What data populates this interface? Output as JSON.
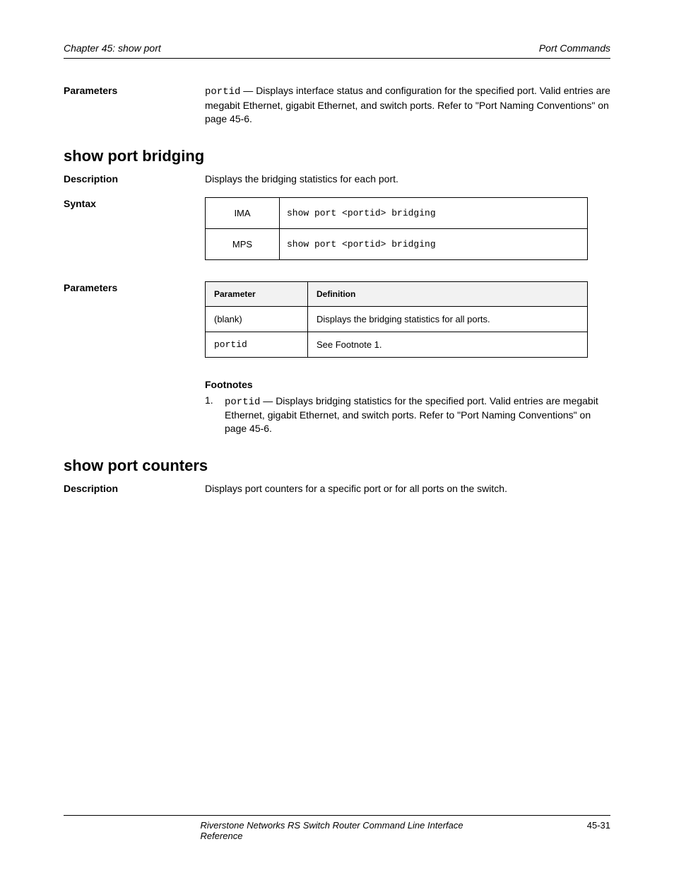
{
  "header": {
    "left": "Chapter 45: show port",
    "right": "Port Commands"
  },
  "parameters_block": {
    "label": "Parameters",
    "body_prefix_mono": "portid",
    "body_text": " — Displays interface status and configuration for the specified port. Valid entries are megabit Ethernet, gigabit Ethernet, and switch ports. Refer to \"Port Naming Conventions\" on page 45-6."
  },
  "sections": [
    {
      "title": "show port bridging",
      "description_label": "Description",
      "description_body": "Displays the bridging statistics for each port.",
      "syntax_label": "Syntax",
      "syntax_rows": [
        {
          "type": "IMA",
          "def": "show port <portid> bridging"
        },
        {
          "type": "MPS",
          "def": "show port <portid> bridging"
        }
      ],
      "parameters_label": "Parameters",
      "parm_headers": [
        "Parameter",
        "Definition"
      ],
      "parm_rows": [
        {
          "parm": "(blank)",
          "def": "Displays the bridging statistics for all ports."
        },
        {
          "parm": "portid",
          "def": "See Footnote 1."
        }
      ],
      "footnotes_label": "Footnotes",
      "footnotes": [
        {
          "num": "1.",
          "prefix_mono": "portid",
          "text": " — Displays bridging statistics for the specified port. Valid entries are megabit Ethernet, gigabit Ethernet, and switch ports. Refer to \"Port Naming Conventions\" on page 45-6."
        }
      ]
    },
    {
      "title": "show port counters",
      "description_label": "Description",
      "description_body": "Displays port counters for a specific port or for all ports on the switch."
    }
  ],
  "footer": {
    "left": "",
    "center": "Riverstone Networks RS Switch Router Command Line Interface Reference",
    "right": "45-31"
  }
}
